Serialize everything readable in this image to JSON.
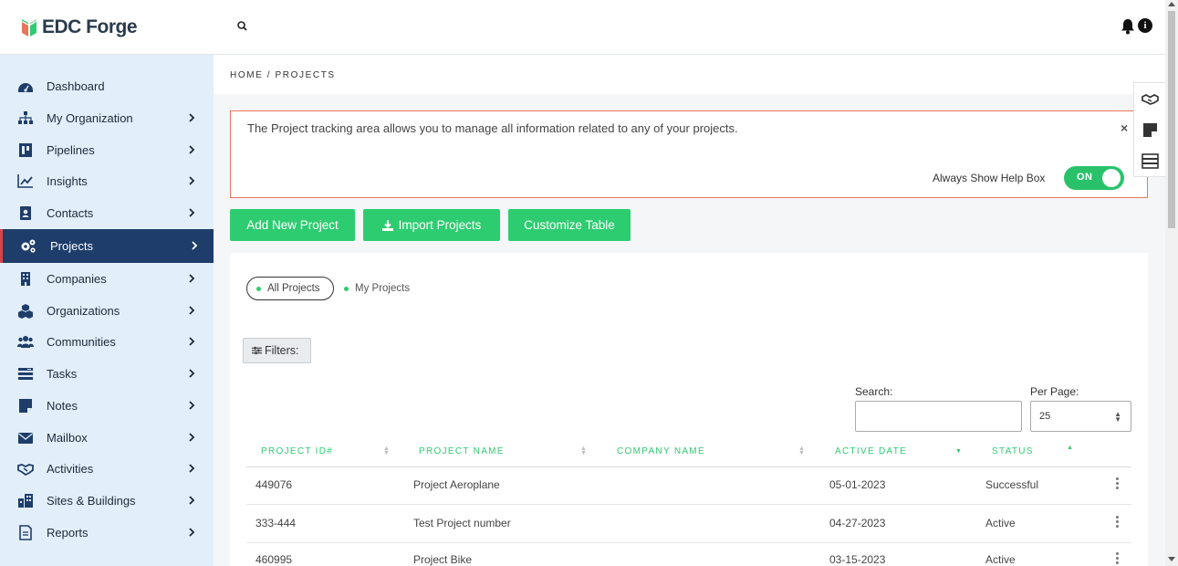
{
  "app": {
    "logo_text": "EDC Forge"
  },
  "sidebar": {
    "items": [
      {
        "label": "Dashboard",
        "icon": "dashboard-icon"
      },
      {
        "label": "My Organization",
        "icon": "org-chart-icon"
      },
      {
        "label": "Pipelines",
        "icon": "pipeline-icon"
      },
      {
        "label": "Insights",
        "icon": "line-chart-icon"
      },
      {
        "label": "Contacts",
        "icon": "contact-card-icon"
      },
      {
        "label": "Projects",
        "icon": "gears-icon"
      },
      {
        "label": "Companies",
        "icon": "building-icon"
      },
      {
        "label": "Organizations",
        "icon": "cubes-icon"
      },
      {
        "label": "Communities",
        "icon": "users-icon"
      },
      {
        "label": "Tasks",
        "icon": "tasks-icon"
      },
      {
        "label": "Notes",
        "icon": "note-icon"
      },
      {
        "label": "Mailbox",
        "icon": "envelope-icon"
      },
      {
        "label": "Activities",
        "icon": "handshake-icon"
      },
      {
        "label": "Sites & Buildings",
        "icon": "city-icon"
      },
      {
        "label": "Reports",
        "icon": "report-icon"
      }
    ],
    "active": "Projects"
  },
  "breadcrumb": "HOME / PROJECTS",
  "help": {
    "message": "The Project tracking area allows you to manage all information related to any of your projects.",
    "close": "×",
    "always_show_label": "Always Show Help Box",
    "toggle_label": "ON",
    "toggle_on": true
  },
  "actions": {
    "add": "Add New Project",
    "import": "Import Projects",
    "customize": "Customize Table"
  },
  "views": {
    "all": "All Projects",
    "mine": "My Projects",
    "selected": "All Projects"
  },
  "filters_label": "Filters:",
  "search": {
    "label": "Search:",
    "value": ""
  },
  "per_page": {
    "label": "Per Page:",
    "value": "25"
  },
  "table": {
    "columns": [
      "PROJECT ID#",
      "PROJECT NAME",
      "COMPANY NAME",
      "ACTIVE DATE",
      "STATUS"
    ],
    "rows": [
      {
        "id": "449076",
        "name": "Project Aeroplane",
        "company": "",
        "date": "05-01-2023",
        "status": "Successful"
      },
      {
        "id": "333-444",
        "name": "Test Project number",
        "company": "",
        "date": "04-27-2023",
        "status": "Active"
      },
      {
        "id": "460995",
        "name": "Project Bike",
        "company": "",
        "date": "03-15-2023",
        "status": "Active"
      }
    ]
  },
  "colors": {
    "accent": "#2ecc71",
    "sidebar_bg": "#e2effa",
    "sidebar_active": "#1e3d6b",
    "help_border": "#e8765b"
  }
}
